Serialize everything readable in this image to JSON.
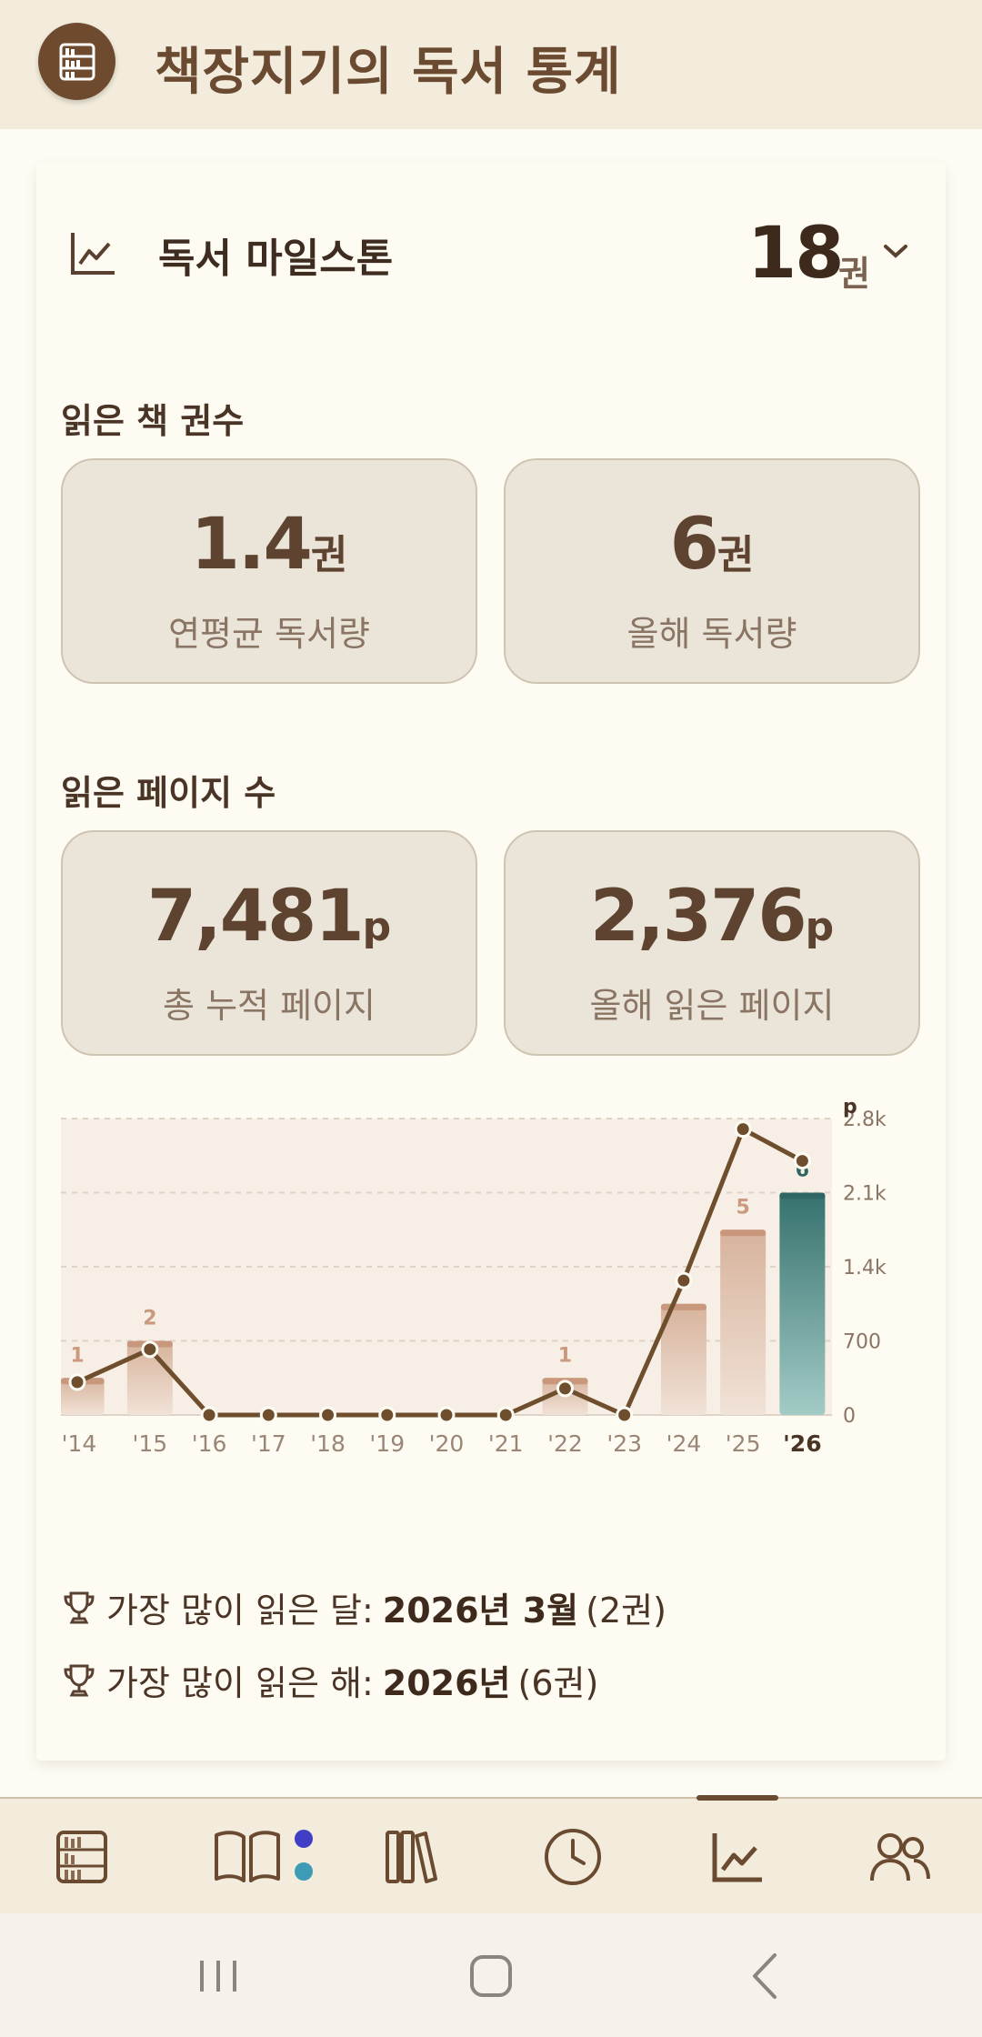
{
  "app": {
    "title": "책장지기의 독서 통계"
  },
  "milestone": {
    "title": "독서 마일스톤",
    "count": "18",
    "unit": "권"
  },
  "books_section": {
    "label": "읽은 책 권수",
    "cards": [
      {
        "value": "1.4",
        "unit": "권",
        "label": "연평균 독서량"
      },
      {
        "value": "6",
        "unit": "권",
        "label": "올해 독서량"
      }
    ]
  },
  "pages_section": {
    "label": "읽은 페이지 수",
    "cards": [
      {
        "value": "7,481",
        "unit": "p",
        "label": "총 누적 페이지"
      },
      {
        "value": "2,376",
        "unit": "p",
        "label": "올해 읽은 페이지"
      }
    ]
  },
  "chart_data": {
    "type": "bar",
    "categories": [
      "'14",
      "'15",
      "'16",
      "'17",
      "'18",
      "'19",
      "'20",
      "'21",
      "'22",
      "'23",
      "'24",
      "'25",
      "'26"
    ],
    "y_axis_unit": "p",
    "y_ticks": [
      "0",
      "700",
      "1.4k",
      "2.1k",
      "2.8k"
    ],
    "ylim": [
      0,
      2800
    ],
    "series": [
      {
        "kind": "bar",
        "values": [
          350,
          700,
          0,
          0,
          0,
          0,
          0,
          0,
          350,
          0,
          1050,
          1750,
          2100
        ],
        "labels": [
          "1",
          "2",
          "",
          "",
          "",
          "",
          "",
          "",
          "1",
          "",
          "",
          "5",
          "6"
        ]
      },
      {
        "kind": "line",
        "values": [
          310,
          620,
          0,
          0,
          0,
          0,
          0,
          0,
          250,
          0,
          1270,
          2700,
          2400
        ]
      }
    ],
    "highlight_index": 12,
    "colors": {
      "bar": "#d9b8a3",
      "bar_highlight": "#3c7e7a",
      "line": "#6e4e2c",
      "grid": "#ddd3c6"
    }
  },
  "highlights": {
    "best_month": {
      "prefix": "가장 많이 읽은 달:",
      "value": "2026년 3월",
      "suffix": "(2권)"
    },
    "best_year": {
      "prefix": "가장 많이 읽은 해:",
      "value": "2026년",
      "suffix": "(6권)"
    }
  },
  "nav": {
    "items": [
      "bookshelf-icon",
      "open-book-icon",
      "books-icon",
      "clock-icon",
      "chart-line-icon",
      "users-icon"
    ],
    "active": 4,
    "dot_colors": [
      "#3f3ec4",
      "#3e9bb5"
    ]
  }
}
